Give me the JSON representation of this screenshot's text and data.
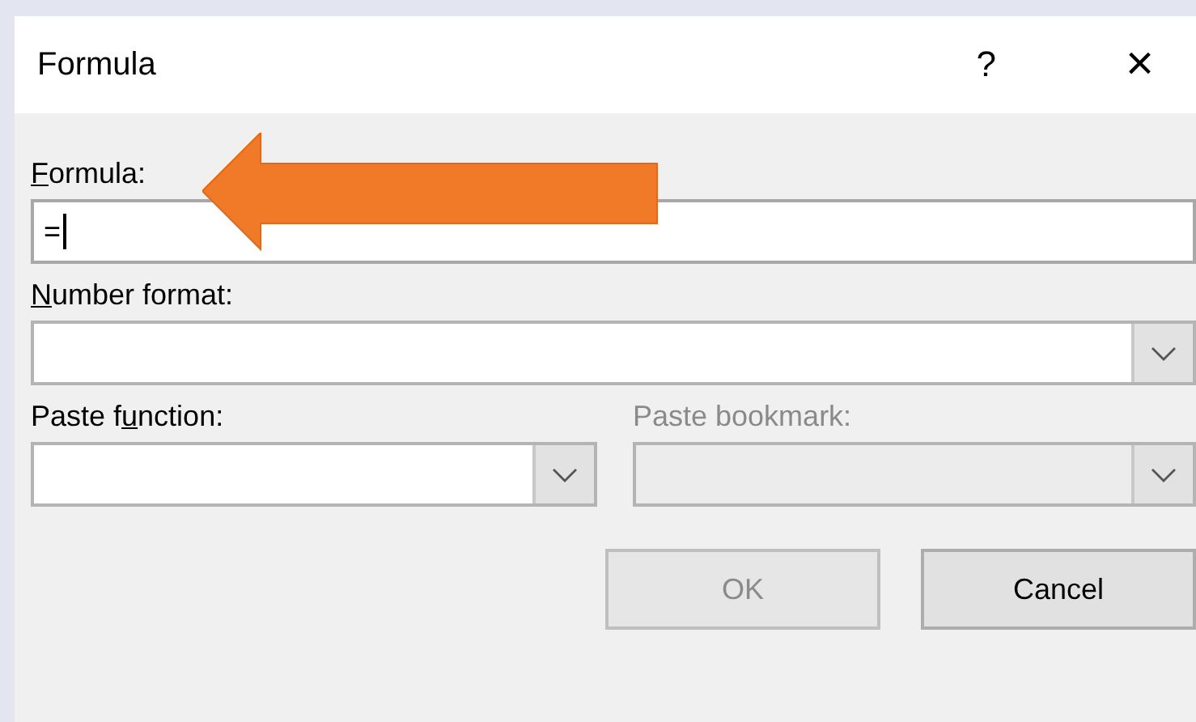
{
  "window": {
    "title": "Formula",
    "help": "?",
    "close": "×"
  },
  "fields": [
    {
      "kind": "text",
      "access_key": "F",
      "label_after": "ormula:",
      "value": "=",
      "focused": true,
      "disabled": false
    },
    {
      "kind": "combo",
      "access_key": "N",
      "label_after": "umber format:",
      "focused": false,
      "disabled": false
    },
    {
      "kind": "combo",
      "label_before": "Paste f",
      "access_key": "u",
      "label_after": "nction:",
      "focused": false,
      "disabled": false
    },
    {
      "kind": "combo",
      "label_before": "Paste bookmark:",
      "focused": false,
      "disabled": true
    }
  ],
  "buttons": [
    {
      "label": "OK",
      "disabled": true
    },
    {
      "label": "Cancel",
      "disabled": false
    }
  ]
}
